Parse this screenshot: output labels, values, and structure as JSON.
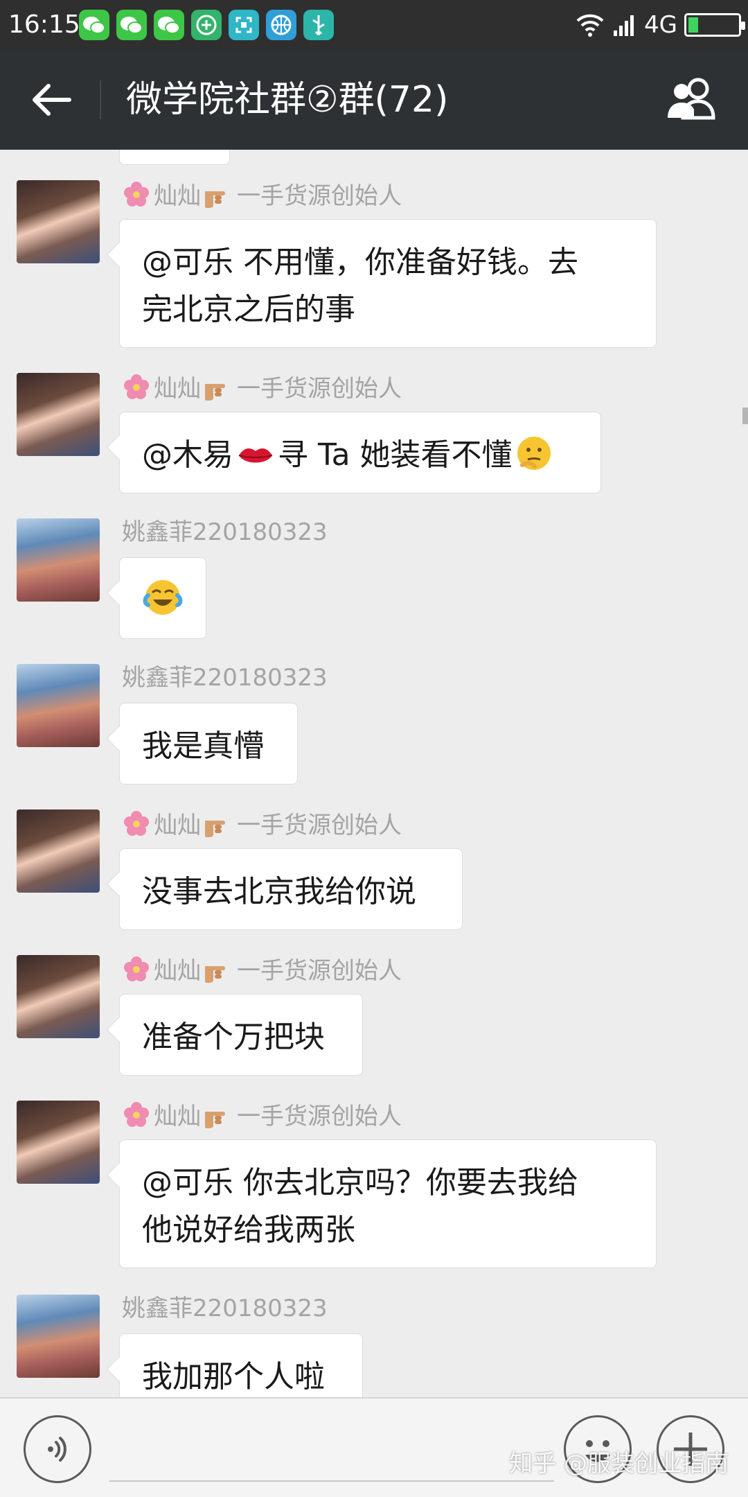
{
  "status_bar": {
    "time": "16:15",
    "network": "4G",
    "notification_icons": [
      "wechat-icon",
      "wechat-icon",
      "wechat-icon",
      "add-circle-icon",
      "scan-icon",
      "basketball-icon",
      "usb-icon"
    ]
  },
  "header": {
    "title": "微学院社群②群(72)"
  },
  "messages": [
    {
      "sender": "灿灿",
      "sender_suffix": "一手货源创始人",
      "text_lines": [
        "@可乐  不用懂，你准备好钱。去",
        "完北京之后的事"
      ],
      "avatar": "a"
    },
    {
      "sender": "灿灿",
      "sender_suffix": "一手货源创始人",
      "text_before": "@木易",
      "text_after": "寻 Ta  她装看不懂",
      "avatar": "a"
    },
    {
      "sender": "姚鑫菲220180323",
      "text": "",
      "avatar": "b"
    },
    {
      "sender": "姚鑫菲220180323",
      "text": "我是真懵",
      "avatar": "b"
    },
    {
      "sender": "灿灿",
      "sender_suffix": "一手货源创始人",
      "text": "没事去北京我给你说",
      "avatar": "a"
    },
    {
      "sender": "灿灿",
      "sender_suffix": "一手货源创始人",
      "text": "准备个万把块",
      "avatar": "a"
    },
    {
      "sender": "灿灿",
      "sender_suffix": "一手货源创始人",
      "text_lines": [
        "@可乐  你去北京吗？你要去我给",
        "他说好给我两张"
      ],
      "avatar": "a"
    },
    {
      "sender": "姚鑫菲220180323",
      "text": "我加那个人啦",
      "avatar": "b"
    }
  ],
  "watermark": "知乎 @服装创业指南",
  "colors": {
    "status_bar": "#2f2f30",
    "nav_bar": "#2e3133",
    "chat_bg": "#ededed",
    "bubble": "#ffffff",
    "sender_name": "#a4a4a4"
  }
}
